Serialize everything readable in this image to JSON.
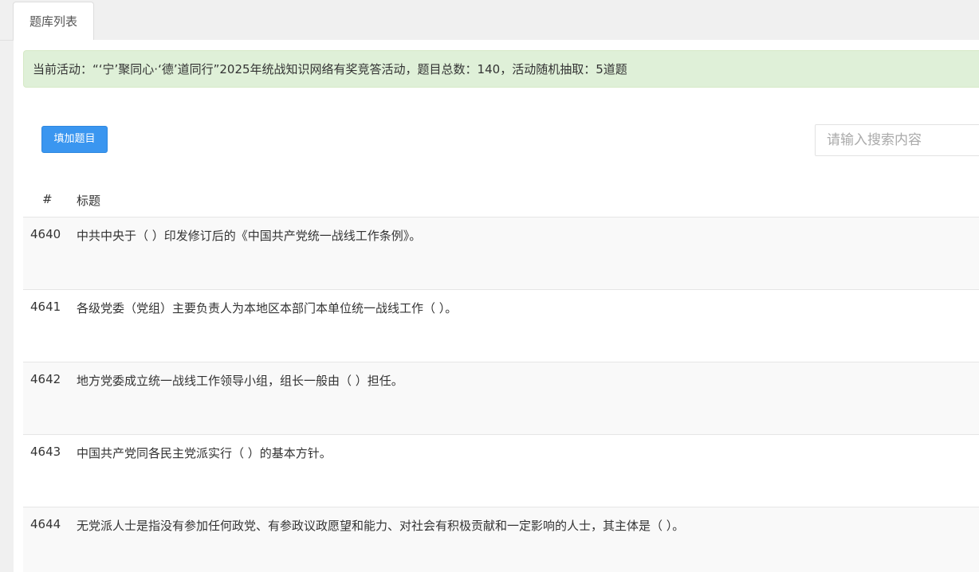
{
  "tabs": [
    {
      "label": "题库列表"
    }
  ],
  "alert": {
    "text": "当前活动：“‘宁’聚同心·‘德’道同行”2025年统战知识网络有奖竞答活动，题目总数：140，活动随机抽取：5道题"
  },
  "toolbar": {
    "add_label": "填加题目",
    "search_placeholder": "请输入搜索内容"
  },
  "table": {
    "headers": {
      "id": "#",
      "title": "标题"
    },
    "rows": [
      {
        "id": "4640",
        "title": "中共中央于（ ）印发修订后的《中国共产党统一战线工作条例》。"
      },
      {
        "id": "4641",
        "title": "各级党委（党组）主要负责人为本地区本部门本单位统一战线工作（ ）。"
      },
      {
        "id": "4642",
        "title": "地方党委成立统一战线工作领导小组，组长一般由（ ）担任。"
      },
      {
        "id": "4643",
        "title": "中国共产党同各民主党派实行（ ）的基本方针。"
      },
      {
        "id": "4644",
        "title": "无党派人士是指没有参加任何政党、有参政议政愿望和能力、对社会有积极贡献和一定影响的人士，其主体是（ ）。"
      }
    ]
  }
}
